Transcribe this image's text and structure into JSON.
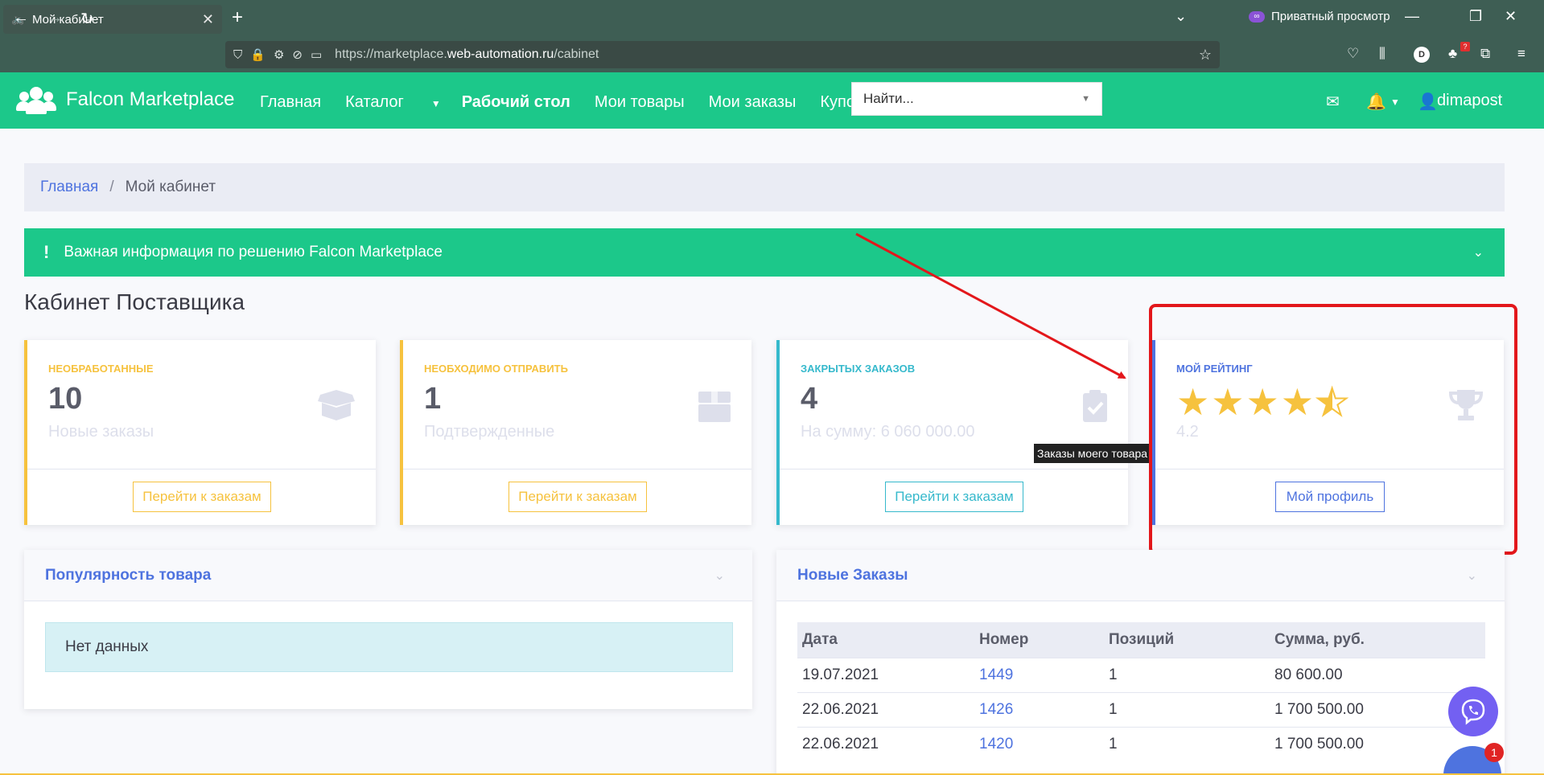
{
  "browser": {
    "tab_title": "Мой кабинет",
    "private_label": "Приватный просмотр",
    "url_prefix": "https://marketplace.",
    "url_host": "web-automation.ru",
    "url_path": "/cabinet",
    "account_letter": "D",
    "ext_badge": "?"
  },
  "app": {
    "brand": "Falcon Marketplace",
    "nav": {
      "home": "Главная",
      "catalog": "Каталог",
      "desktop": "Рабочий стол",
      "my_goods": "Мои товары",
      "my_orders": "Мои заказы",
      "coupons": "Купоны"
    },
    "search_placeholder": "Найти...",
    "username": "dimapost"
  },
  "breadcrumb": {
    "home": "Главная",
    "sep": "/",
    "current": "Мой кабинет"
  },
  "info_bar": {
    "text": "Важная информация по решению Falcon Marketplace",
    "excl": "!"
  },
  "page_title": "Кабинет Поставщика",
  "cards": [
    {
      "label": "Необработанные",
      "value": "10",
      "sub": "Новые заказы",
      "button": "Перейти к заказам",
      "color": "#f6c23e"
    },
    {
      "label": "Необходимо отправить",
      "value": "1",
      "sub": "Подтвержденные",
      "button": "Перейти к заказам",
      "color": "#f6c23e"
    },
    {
      "label": "Закрытых заказов",
      "value": "4",
      "sub": "На сумму: 6 060 000.00",
      "button": "Перейти к заказам",
      "color": "#36b9cc"
    },
    {
      "label": "Мой рейтинг",
      "rating": 4.2,
      "sub": "4.2",
      "button": "Мой профиль",
      "color": "#4e73df"
    }
  ],
  "tooltip": "Заказы моего товара",
  "popularity": {
    "title": "Популярность товара",
    "empty": "Нет данных"
  },
  "new_orders": {
    "title": "Новые Заказы",
    "columns": [
      "Дата",
      "Номер",
      "Позиций",
      "Сумма, руб."
    ],
    "rows": [
      [
        "19.07.2021",
        "1449",
        "1",
        "80 600.00"
      ],
      [
        "22.06.2021",
        "1426",
        "1",
        "1 700 500.00"
      ],
      [
        "22.06.2021",
        "1420",
        "1",
        "1 700 500.00"
      ]
    ]
  },
  "chat_badge": "1",
  "colors": {
    "primary": "#4e73df",
    "success": "#1cc88a",
    "warning": "#f6c23e",
    "info": "#36b9cc",
    "annotation": "#e3171b"
  }
}
